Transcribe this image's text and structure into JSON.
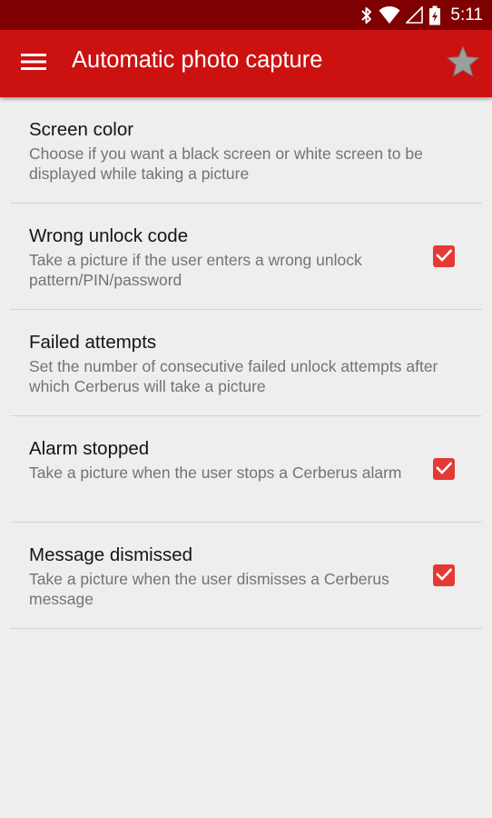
{
  "status_bar": {
    "time": "5:11",
    "icons": [
      "bluetooth-icon",
      "wifi-icon",
      "cell-signal-icon",
      "battery-charging-icon"
    ]
  },
  "app_bar": {
    "title": "Automatic photo capture",
    "menu_icon": "hamburger-menu-icon",
    "action_icon": "star-icon"
  },
  "colors": {
    "status_bar": "#7f0000",
    "app_bar": "#cc1111",
    "checkbox": "#e53935",
    "background": "#eeeeee"
  },
  "settings": [
    {
      "title": "Screen color",
      "summary": "Choose if you want a black screen or white screen to be displayed while taking a picture",
      "has_checkbox": false
    },
    {
      "title": "Wrong unlock code",
      "summary": "Take a picture if the user enters a wrong unlock pattern/PIN/password",
      "has_checkbox": true,
      "checked": true
    },
    {
      "title": "Failed attempts",
      "summary": "Set the number of consecutive failed unlock attempts after which Cerberus will take a picture",
      "has_checkbox": false
    },
    {
      "title": "Alarm stopped",
      "summary": "Take a picture when the user stops a Cerberus alarm",
      "has_checkbox": true,
      "checked": true
    },
    {
      "title": "Message dismissed",
      "summary": "Take a picture when the user dismisses a Cerberus message",
      "has_checkbox": true,
      "checked": true
    }
  ]
}
